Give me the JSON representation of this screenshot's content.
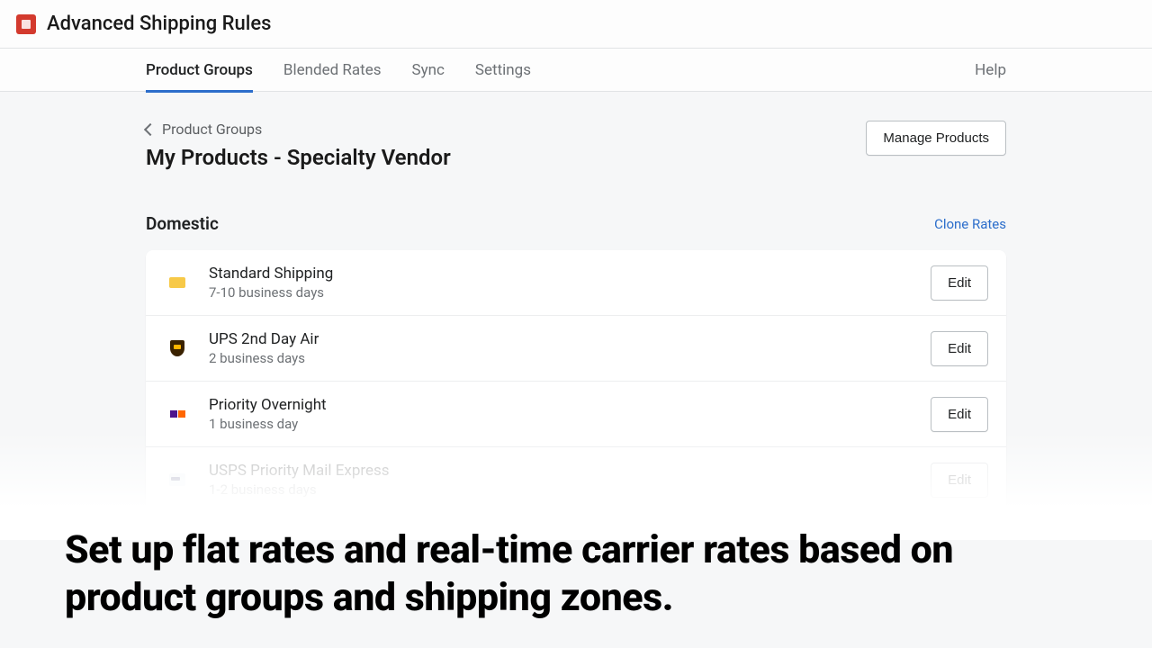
{
  "header": {
    "app_title": "Advanced Shipping Rules"
  },
  "tabs": {
    "items": [
      {
        "label": "Product Groups",
        "active": true
      },
      {
        "label": "Blended Rates",
        "active": false
      },
      {
        "label": "Sync",
        "active": false
      },
      {
        "label": "Settings",
        "active": false
      }
    ],
    "help": "Help"
  },
  "breadcrumb": {
    "back_label": "Product Groups",
    "page_title": "My Products - Specialty Vendor",
    "manage_button": "Manage Products"
  },
  "section": {
    "title": "Domestic",
    "clone_label": "Clone Rates"
  },
  "rates": [
    {
      "name": "Standard Shipping",
      "subtitle": "7-10 business days",
      "icon": "box",
      "edit": "Edit"
    },
    {
      "name": "UPS 2nd Day Air",
      "subtitle": "2 business days",
      "icon": "ups",
      "edit": "Edit"
    },
    {
      "name": "Priority Overnight",
      "subtitle": "1 business day",
      "icon": "fedex",
      "edit": "Edit"
    },
    {
      "name": "USPS Priority Mail Express",
      "subtitle": "1-2 business days",
      "icon": "usps",
      "edit": "Edit"
    }
  ],
  "promo": {
    "text": "Set up flat rates and real-time carrier rates based on product groups and shipping zones."
  }
}
